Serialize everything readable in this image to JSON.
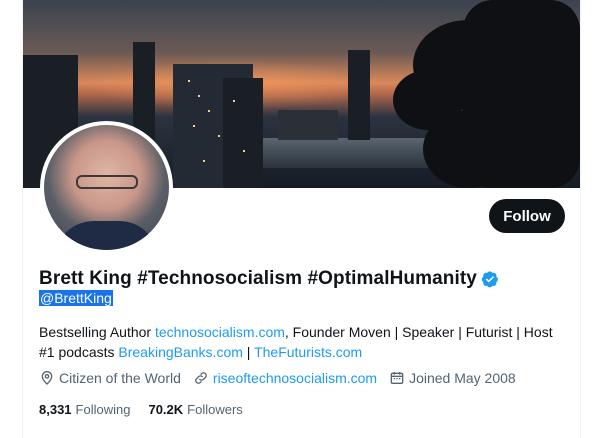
{
  "profile": {
    "display_name": "Brett King #Technosocialism #OptimalHumanity",
    "handle": "@BrettKing",
    "follow_label": "Follow",
    "bio": {
      "part1": "Bestselling Author ",
      "link1": "technosocialism.com",
      "part2": ", Founder Moven | Speaker | Futurist | Host #1 podcasts ",
      "link2": "BreakingBanks.com",
      "part3": " | ",
      "link3": "TheFuturists.com"
    },
    "location": "Citizen of the World",
    "website": "riseoftechnosocialism.com",
    "joined": "Joined May 2008",
    "following_count": "8,331",
    "following_label": "Following",
    "followers_count": "70.2K",
    "followers_label": "Followers"
  },
  "icons": {
    "location": "location-pin-icon",
    "link": "link-icon",
    "calendar": "calendar-icon",
    "verified": "verified-badge-icon"
  },
  "colors": {
    "accent": "#1d9bf0",
    "text": "#0f1419",
    "muted": "#536471",
    "button": "#0f1419",
    "selection": "#1a73e8"
  }
}
